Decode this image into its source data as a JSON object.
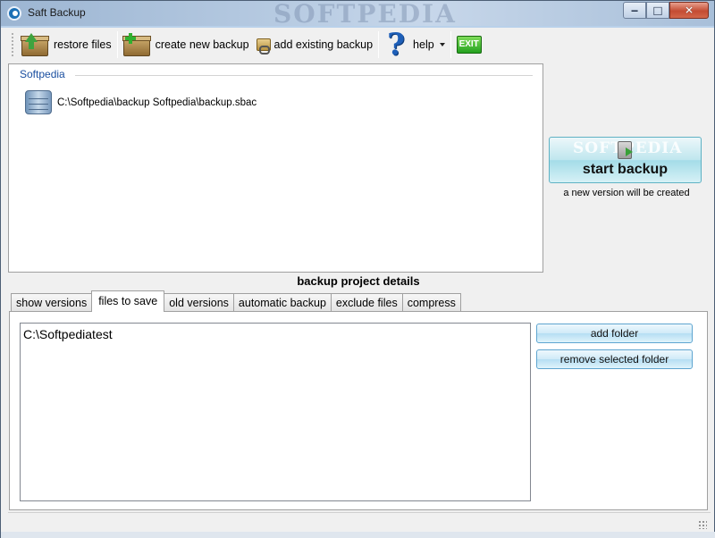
{
  "window": {
    "title": "Saft Backup",
    "watermark": "SOFTPEDIA",
    "controls": {
      "minimize": "‒",
      "maximize": "□",
      "close": "✕"
    }
  },
  "toolbar": {
    "restore_label": "restore files",
    "create_label": "create new backup",
    "add_existing_label": "add existing backup",
    "help_label": "help",
    "exit_label": "EXIT"
  },
  "projects": {
    "group_name": "Softpedia",
    "items": [
      {
        "path": "C:\\Softpedia\\backup Softpedia\\backup.sbac"
      }
    ]
  },
  "start_backup": {
    "label": "start backup",
    "watermark": "SOFTPEDIA",
    "note": "a new version will be created"
  },
  "details": {
    "title": "backup project details",
    "tabs": [
      "show versions",
      "files to save",
      "old versions",
      "automatic backup",
      "exclude files",
      "compress"
    ],
    "active_tab": "files to save",
    "folders": [
      "C:\\Softpediatest"
    ],
    "add_folder_label": "add folder",
    "remove_folder_label": "remove selected folder"
  },
  "colors": {
    "group_header": "#1b4fa0",
    "button_accent": "#5ea5d0",
    "exit_green": "#24a11f"
  }
}
